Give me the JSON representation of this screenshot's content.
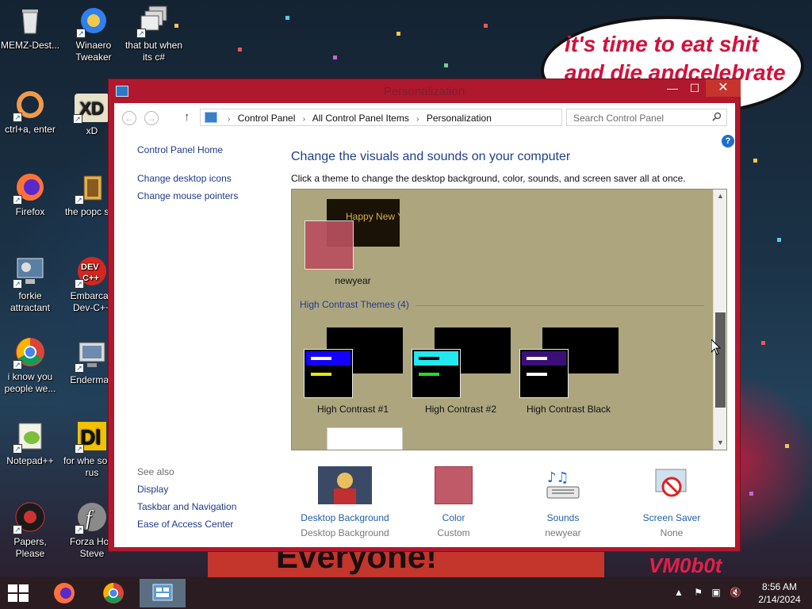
{
  "desktop": {
    "icons": [
      {
        "label": "MEMZ-Dest...",
        "glyph": "recycle-bin-icon"
      },
      {
        "label": "Winaero Tweaker",
        "glyph": "winaero-icon"
      },
      {
        "label": "that but when its c#",
        "glyph": "stacked-windows-icon"
      },
      {
        "label": "ctrl+a, enter",
        "glyph": "orange-ring-icon"
      },
      {
        "label": "xD",
        "glyph": "xd-icon"
      },
      {
        "label": "Firefox",
        "glyph": "firefox-icon"
      },
      {
        "label": "the popc shit",
        "glyph": "popcorn-icon"
      },
      {
        "label": "forkie attractant",
        "glyph": "computer-gear-icon"
      },
      {
        "label": "Embarcad Dev-C++",
        "glyph": "devcpp-icon"
      },
      {
        "label": "i know you people we...",
        "glyph": "chrome-icon"
      },
      {
        "label": "Enderman",
        "glyph": "monitor-icon"
      },
      {
        "label": "Notepad++",
        "glyph": "notepadpp-icon"
      },
      {
        "label": "for whe some rus",
        "glyph": "app-icon"
      },
      {
        "label": "Papers, Please",
        "glyph": "papers-please-icon"
      },
      {
        "label": "Forza Hori Steve",
        "glyph": "flash-icon"
      }
    ],
    "speech_bubble": "it's time to eat shit and die andcelebrate",
    "banner_text": "Everyone!",
    "signature": "VM0b0t"
  },
  "window": {
    "title": "Personalization",
    "controls": {
      "minimize": "—",
      "maximize": "☐",
      "close": "✕"
    },
    "nav": {
      "back": "←",
      "forward": "→",
      "up": "↑",
      "refresh": "⟳",
      "dropdown": "⌄"
    },
    "breadcrumb": [
      "Control Panel",
      "All Control Panel Items",
      "Personalization"
    ],
    "search_placeholder": "Search Control Panel",
    "help": "?",
    "left_pane": {
      "home": "Control Panel Home",
      "links": [
        "Change desktop icons",
        "Change mouse pointers"
      ]
    },
    "see_also": {
      "title": "See also",
      "links": [
        "Display",
        "Taskbar and Navigation",
        "Ease of Access Center"
      ]
    },
    "heading": "Change the visuals and sounds on your computer",
    "subheading": "Click a theme to change the desktop background, color, sounds, and screen saver all at once.",
    "themes": {
      "my_theme": {
        "name": "newyear",
        "preview_text": "Happy New Year!"
      },
      "group_title": "High Contrast Themes (4)",
      "high_contrast": [
        "High Contrast #1",
        "High Contrast #2",
        "High Contrast Black"
      ]
    },
    "bottom_strip": [
      {
        "label": "Desktop Background",
        "value": "Desktop Background",
        "icon": "background-thumbnail"
      },
      {
        "label": "Color",
        "value": "Custom",
        "icon": "color-swatch"
      },
      {
        "label": "Sounds",
        "value": "newyear",
        "icon": "sounds-icon"
      },
      {
        "label": "Screen Saver",
        "value": "None",
        "icon": "screensaver-icon"
      }
    ]
  },
  "taskbar": {
    "apps": [
      "firefox-icon",
      "chrome-icon",
      "control-panel-icon"
    ],
    "time": "8:56 AM",
    "date": "2/14/2024"
  },
  "colors": {
    "window_frame": "#b0182e",
    "theme_panel_bg": "#aca57e",
    "link_blue": "#1e3a8a",
    "color_swatch": "#c05a68"
  }
}
